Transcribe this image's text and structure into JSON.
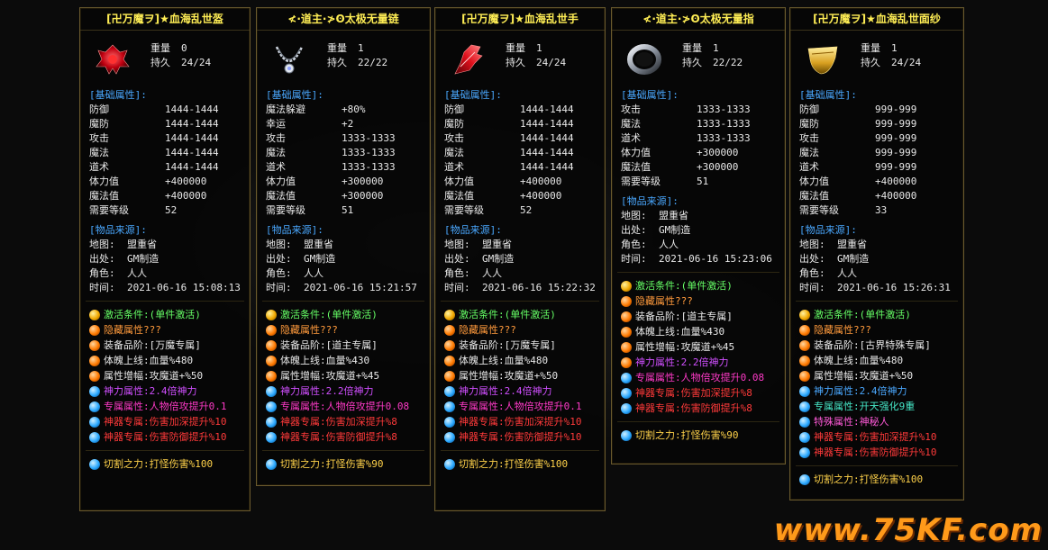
{
  "colors": {
    "title": "#ffee55",
    "section": "#4aa8ff",
    "value": "#e8e8e8",
    "activation": "#66ff66",
    "hidden": "#ff9a3c",
    "god": "#d04fff",
    "exclusive": "#ff3ac8",
    "artifact": "#ff3a3a",
    "cut": "#ffd24a",
    "special_blue": "#4aa8ff",
    "special_green": "#46e8c8",
    "special_pink": "#ff5ad8",
    "watermark": "#ff9a1a"
  },
  "watermark": "www.75KF.com",
  "cards": [
    {
      "title": "[卍万魔ヲ]★血海乱世盔",
      "icon": "red-helmet-icon",
      "weight_label": "重量",
      "weight": "0",
      "durability_label": "持久",
      "durability": "24/24",
      "base_title": "[基础属性]:",
      "base": [
        {
          "k": "防御",
          "v": "1444-1444"
        },
        {
          "k": "魔防",
          "v": "1444-1444"
        },
        {
          "k": "攻击",
          "v": "1444-1444"
        },
        {
          "k": "魔法",
          "v": "1444-1444"
        },
        {
          "k": "道术",
          "v": "1444-1444"
        },
        {
          "k": "体力值",
          "v": "+400000"
        },
        {
          "k": "魔法值",
          "v": "+400000"
        },
        {
          "k": "需要等级",
          "v": "52"
        }
      ],
      "source_title": "[物品来源]:",
      "source": [
        {
          "k": "地图:",
          "v": "盟重省"
        },
        {
          "k": "出处:",
          "v": "GM制造"
        },
        {
          "k": "角色:",
          "v": "人人"
        },
        {
          "k": "时间:",
          "v": "2021-06-16 15:08:13"
        }
      ],
      "lines": [
        {
          "orb": "gold",
          "color": "activation",
          "text": "激活条件:(单件激活)"
        },
        {
          "orb": "orange",
          "color": "hidden",
          "text": "隐藏属性???"
        },
        {
          "orb": "orange",
          "color": "value",
          "text": "装备品阶:[万魔专属]"
        },
        {
          "orb": "orange",
          "color": "value",
          "text": "体魄上线:血量%480"
        },
        {
          "orb": "orange",
          "color": "value",
          "text": "属性增幅:攻魔道+%50"
        },
        {
          "orb": "blue",
          "color": "god",
          "text": "神力属性:2.4倍神力"
        },
        {
          "orb": "blue",
          "color": "exclusive",
          "text": "专属属性:人物倍攻提升0.1"
        },
        {
          "orb": "blue",
          "color": "artifact",
          "text": "神器专属:伤害加深提升%10"
        },
        {
          "orb": "blue",
          "color": "artifact",
          "text": "神器专属:伤害防御提升%10"
        },
        {
          "orb": "blue",
          "color": "cut",
          "text": "切割之力:打怪伤害%100"
        }
      ]
    },
    {
      "title": "≮·道主·≯ʘ太极无量链",
      "icon": "silver-necklace-icon",
      "weight_label": "重量",
      "weight": "1",
      "durability_label": "持久",
      "durability": "22/22",
      "base_title": "[基础属性]:",
      "base": [
        {
          "k": "魔法躲避",
          "v": "+80%"
        },
        {
          "k": "幸运",
          "v": "+2"
        },
        {
          "k": "攻击",
          "v": "1333-1333"
        },
        {
          "k": "魔法",
          "v": "1333-1333"
        },
        {
          "k": "道术",
          "v": "1333-1333"
        },
        {
          "k": "体力值",
          "v": "+300000"
        },
        {
          "k": "魔法值",
          "v": "+300000"
        },
        {
          "k": "需要等级",
          "v": "51"
        }
      ],
      "source_title": "[物品来源]:",
      "source": [
        {
          "k": "地图:",
          "v": "盟重省"
        },
        {
          "k": "出处:",
          "v": "GM制造"
        },
        {
          "k": "角色:",
          "v": "人人"
        },
        {
          "k": "时间:",
          "v": "2021-06-16 15:21:57"
        }
      ],
      "lines": [
        {
          "orb": "gold",
          "color": "activation",
          "text": "激活条件:(单件激活)"
        },
        {
          "orb": "orange",
          "color": "hidden",
          "text": "隐藏属性???"
        },
        {
          "orb": "orange",
          "color": "value",
          "text": "装备品阶:[道主专属]"
        },
        {
          "orb": "orange",
          "color": "value",
          "text": "体魄上线:血量%430"
        },
        {
          "orb": "orange",
          "color": "value",
          "text": "属性增幅:攻魔道+%45"
        },
        {
          "orb": "blue",
          "color": "god",
          "text": "神力属性:2.2倍神力"
        },
        {
          "orb": "blue",
          "color": "exclusive",
          "text": "专属属性:人物倍攻提升0.08"
        },
        {
          "orb": "blue",
          "color": "artifact",
          "text": "神器专属:伤害加深提升%8"
        },
        {
          "orb": "blue",
          "color": "artifact",
          "text": "神器专属:伤害防御提升%8"
        },
        {
          "orb": "blue",
          "color": "cut",
          "text": "切割之力:打怪伤害%90"
        }
      ]
    },
    {
      "title": "[卍万魔ヲ]★血海乱世手",
      "icon": "red-gauntlet-icon",
      "weight_label": "重量",
      "weight": "1",
      "durability_label": "持久",
      "durability": "24/24",
      "base_title": "[基础属性]:",
      "base": [
        {
          "k": "防御",
          "v": "1444-1444"
        },
        {
          "k": "魔防",
          "v": "1444-1444"
        },
        {
          "k": "攻击",
          "v": "1444-1444"
        },
        {
          "k": "魔法",
          "v": "1444-1444"
        },
        {
          "k": "道术",
          "v": "1444-1444"
        },
        {
          "k": "体力值",
          "v": "+400000"
        },
        {
          "k": "魔法值",
          "v": "+400000"
        },
        {
          "k": "需要等级",
          "v": "52"
        }
      ],
      "source_title": "[物品来源]:",
      "source": [
        {
          "k": "地图:",
          "v": "盟重省"
        },
        {
          "k": "出处:",
          "v": "GM制造"
        },
        {
          "k": "角色:",
          "v": "人人"
        },
        {
          "k": "时间:",
          "v": "2021-06-16 15:22:32"
        }
      ],
      "lines": [
        {
          "orb": "gold",
          "color": "activation",
          "text": "激活条件:(单件激活)"
        },
        {
          "orb": "orange",
          "color": "hidden",
          "text": "隐藏属性???"
        },
        {
          "orb": "orange",
          "color": "value",
          "text": "装备品阶:[万魔专属]"
        },
        {
          "orb": "orange",
          "color": "value",
          "text": "体魄上线:血量%480"
        },
        {
          "orb": "orange",
          "color": "value",
          "text": "属性增幅:攻魔道+%50"
        },
        {
          "orb": "blue",
          "color": "god",
          "text": "神力属性:2.4倍神力"
        },
        {
          "orb": "blue",
          "color": "exclusive",
          "text": "专属属性:人物倍攻提升0.1"
        },
        {
          "orb": "blue",
          "color": "artifact",
          "text": "神器专属:伤害加深提升%10"
        },
        {
          "orb": "blue",
          "color": "artifact",
          "text": "神器专属:伤害防御提升%10"
        },
        {
          "orb": "blue",
          "color": "cut",
          "text": "切割之力:打怪伤害%100"
        }
      ]
    },
    {
      "title": "≮·道主·≯ʘ太极无量指",
      "icon": "silver-ring-icon",
      "weight_label": "重量",
      "weight": "1",
      "durability_label": "持久",
      "durability": "22/22",
      "base_title": "[基础属性]:",
      "base": [
        {
          "k": "攻击",
          "v": "1333-1333"
        },
        {
          "k": "魔法",
          "v": "1333-1333"
        },
        {
          "k": "道术",
          "v": "1333-1333"
        },
        {
          "k": "体力值",
          "v": "+300000"
        },
        {
          "k": "魔法值",
          "v": "+300000"
        },
        {
          "k": "需要等级",
          "v": "51"
        }
      ],
      "source_title": "[物品来源]:",
      "source": [
        {
          "k": "地图:",
          "v": "盟重省"
        },
        {
          "k": "出处:",
          "v": "GM制造"
        },
        {
          "k": "角色:",
          "v": "人人"
        },
        {
          "k": "时间:",
          "v": "2021-06-16 15:23:06"
        }
      ],
      "lines": [
        {
          "orb": "gold",
          "color": "activation",
          "text": "激活条件:(单件激活)"
        },
        {
          "orb": "orange",
          "color": "hidden",
          "text": "隐藏属性???"
        },
        {
          "orb": "orange",
          "color": "value",
          "text": "装备品阶:[道主专属]"
        },
        {
          "orb": "orange",
          "color": "value",
          "text": "体魄上线:血量%430"
        },
        {
          "orb": "orange",
          "color": "value",
          "text": "属性增幅:攻魔道+%45"
        },
        {
          "orb": "orange",
          "color": "god",
          "text": "神力属性:2.2倍神力"
        },
        {
          "orb": "blue",
          "color": "exclusive",
          "text": "专属属性:人物倍攻提升0.08"
        },
        {
          "orb": "blue",
          "color": "artifact",
          "text": "神器专属:伤害加深提升%8"
        },
        {
          "orb": "blue",
          "color": "artifact",
          "text": "神器专属:伤害防御提升%8"
        },
        {
          "orb": "blue",
          "color": "cut",
          "text": "切割之力:打怪伤害%90"
        }
      ]
    },
    {
      "title": "[卍万魔ヲ]★血海乱世面纱",
      "icon": "gold-veil-icon",
      "weight_label": "重量",
      "weight": "1",
      "durability_label": "持久",
      "durability": "24/24",
      "base_title": "[基础属性]:",
      "base": [
        {
          "k": "防御",
          "v": "999-999"
        },
        {
          "k": "魔防",
          "v": "999-999"
        },
        {
          "k": "攻击",
          "v": "999-999"
        },
        {
          "k": "魔法",
          "v": "999-999"
        },
        {
          "k": "道术",
          "v": "999-999"
        },
        {
          "k": "体力值",
          "v": "+400000"
        },
        {
          "k": "魔法值",
          "v": "+400000"
        },
        {
          "k": "需要等级",
          "v": "33"
        }
      ],
      "source_title": "[物品来源]:",
      "source": [
        {
          "k": "地图:",
          "v": "盟重省"
        },
        {
          "k": "出处:",
          "v": "GM制造"
        },
        {
          "k": "角色:",
          "v": "人人"
        },
        {
          "k": "时间:",
          "v": "2021-06-16 15:26:31"
        }
      ],
      "lines": [
        {
          "orb": "gold",
          "color": "activation",
          "text": "激活条件:(单件激活)"
        },
        {
          "orb": "orange",
          "color": "hidden",
          "text": "隐藏属性???"
        },
        {
          "orb": "orange",
          "color": "value",
          "text": "装备品阶:[古界特殊专属]"
        },
        {
          "orb": "orange",
          "color": "value",
          "text": "体魄上线:血量%480"
        },
        {
          "orb": "orange",
          "color": "value",
          "text": "属性增幅:攻魔道+%50"
        },
        {
          "orb": "blue",
          "color": "special_blue",
          "text": "神力属性:2.4倍神力"
        },
        {
          "orb": "blue",
          "color": "special_green",
          "text": "专属属性:开天强化9重"
        },
        {
          "orb": "blue",
          "color": "special_pink",
          "text": "特殊属性:神秘人"
        },
        {
          "orb": "blue",
          "color": "artifact",
          "text": "神器专属:伤害加深提升%10"
        },
        {
          "orb": "blue",
          "color": "artifact",
          "text": "神器专属:伤害防御提升%10"
        },
        {
          "orb": "blue",
          "color": "cut",
          "text": "切割之力:打怪伤害%100"
        }
      ]
    }
  ]
}
